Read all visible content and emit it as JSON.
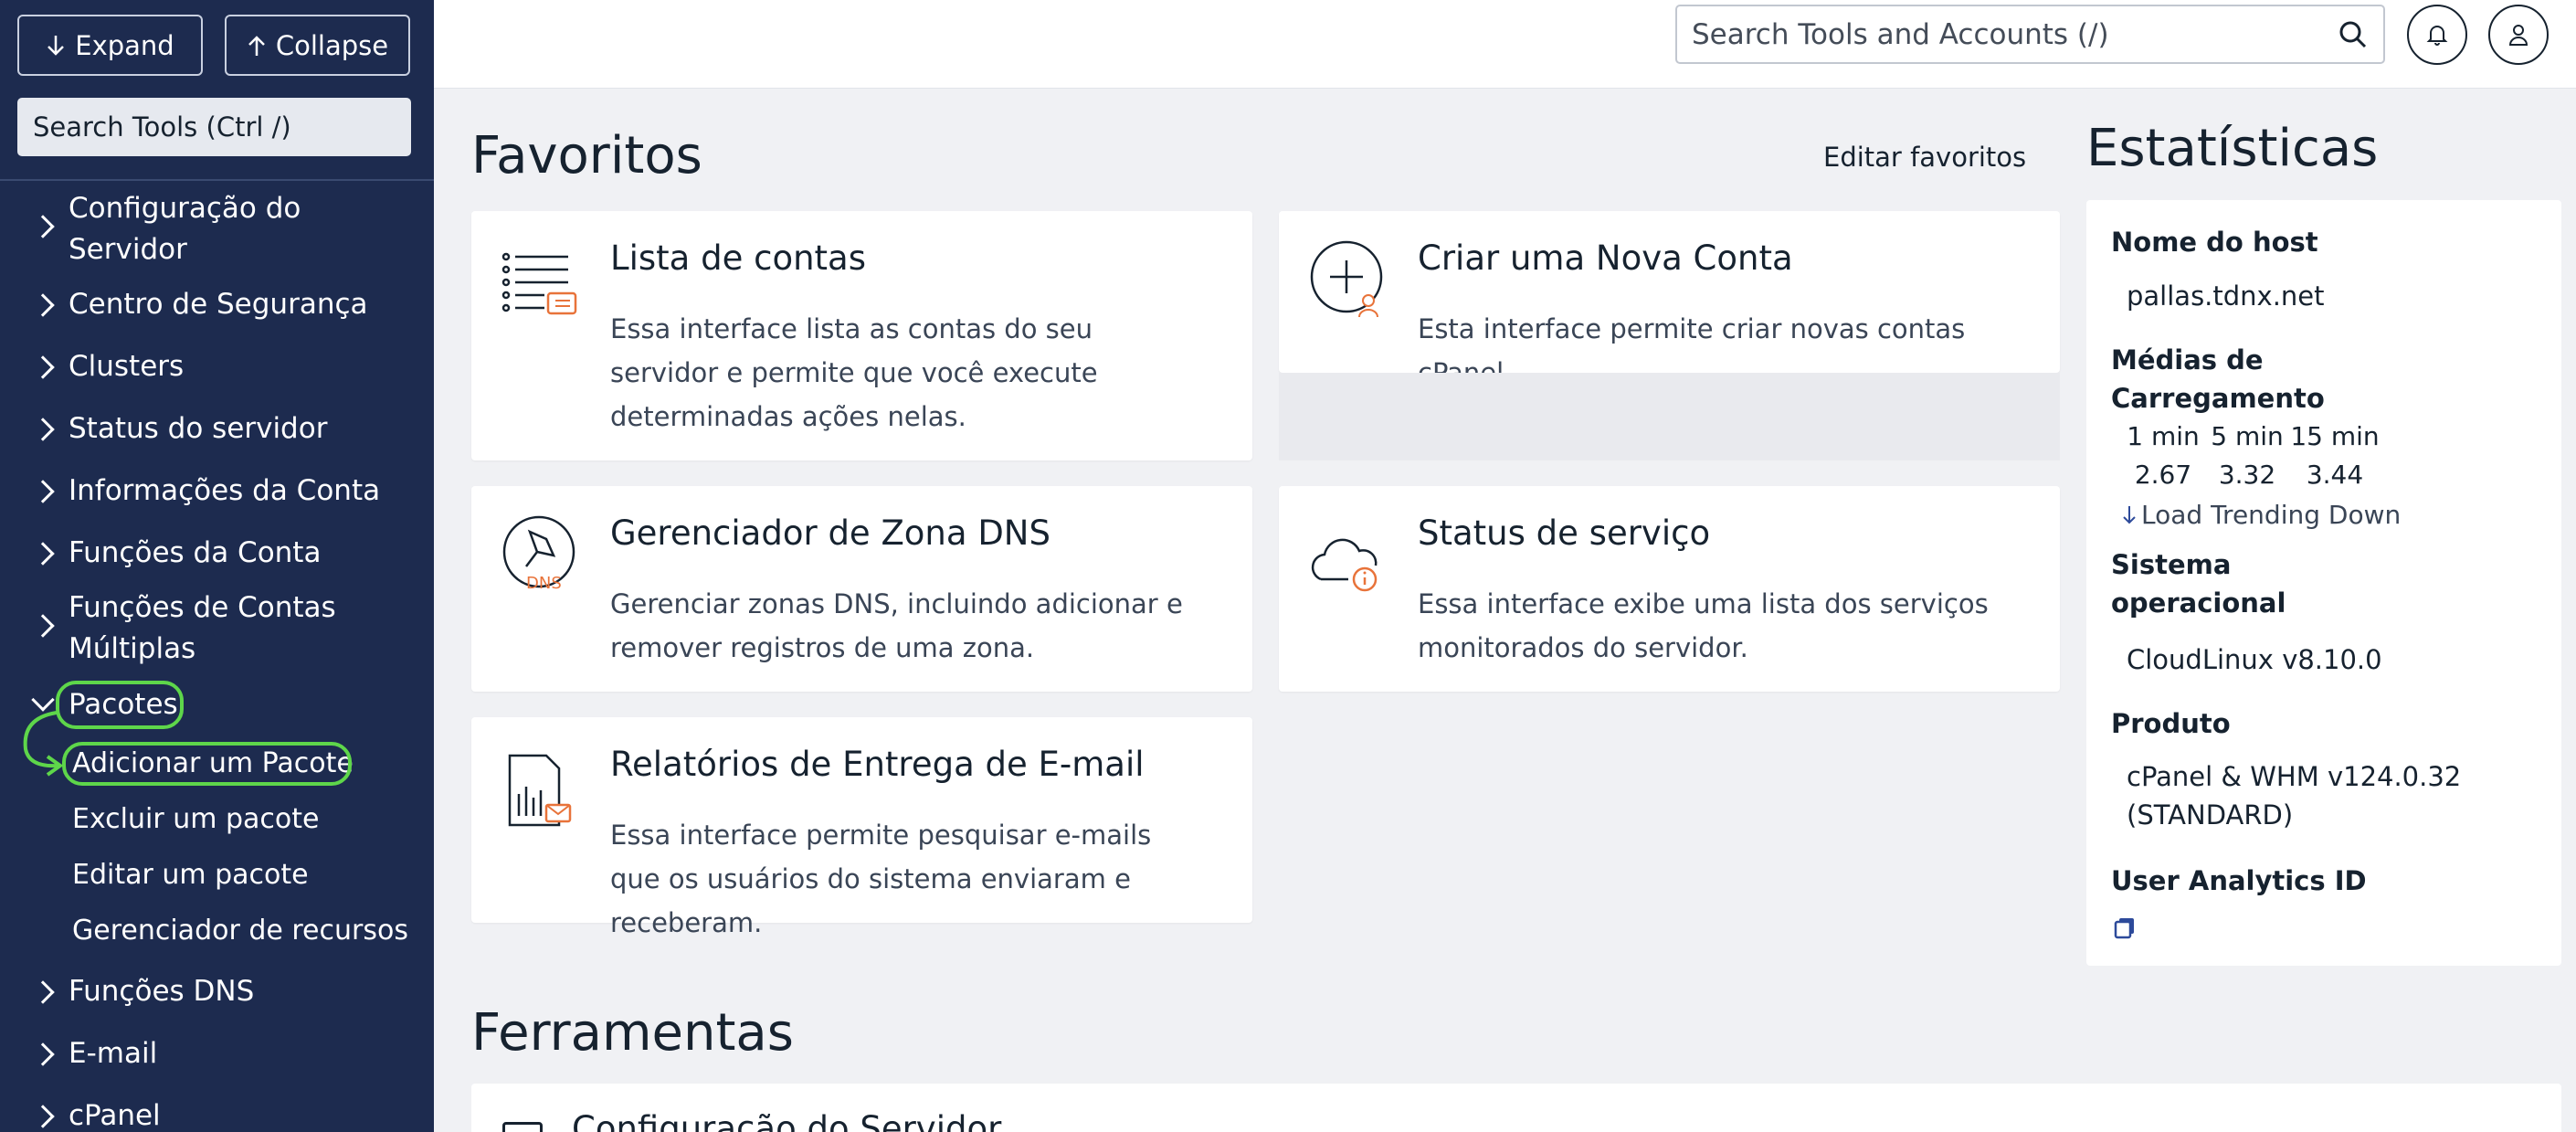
{
  "sidebar": {
    "expand_label": "Expand",
    "collapse_label": "Collapse",
    "search_placeholder": "Search Tools (Ctrl /)",
    "items": [
      {
        "label": "Configuração do Servidor"
      },
      {
        "label": "Centro de Segurança"
      },
      {
        "label": "Clusters"
      },
      {
        "label": "Status do servidor"
      },
      {
        "label": "Informações da Conta"
      },
      {
        "label": "Funções da Conta"
      },
      {
        "label": "Funções de Contas Múltiplas"
      },
      {
        "label": "Pacotes"
      },
      {
        "label": "Funções DNS"
      },
      {
        "label": "E-mail"
      },
      {
        "label": "cPanel"
      }
    ],
    "pacotes_sub": [
      {
        "label": "Adicionar um Pacote"
      },
      {
        "label": "Excluir um pacote"
      },
      {
        "label": "Editar um pacote"
      },
      {
        "label": "Gerenciador de recursos"
      }
    ]
  },
  "header": {
    "search_placeholder": "Search Tools and Accounts (/)"
  },
  "favorites": {
    "title": "Favoritos",
    "edit_label": "Editar favoritos",
    "cards": [
      {
        "title": "Lista de contas",
        "desc": "Essa interface lista as contas do seu servidor e permite que você execute determinadas ações nelas."
      },
      {
        "title": "Criar uma Nova Conta",
        "desc": "Esta interface permite criar novas contas cPanel."
      },
      {
        "title": "Gerenciador de Zona DNS",
        "desc": "Gerenciar zonas DNS, incluindo adicionar e remover registros de uma zona."
      },
      {
        "title": "Status de serviço",
        "desc": "Essa interface exibe uma lista dos serviços monitorados do servidor."
      },
      {
        "title": "Relatórios de Entrega de E-mail",
        "desc": "Essa interface permite pesquisar e-mails que os usuários do sistema enviaram e receberam."
      }
    ],
    "dns_icon_text": "DNS"
  },
  "stats": {
    "title": "Estatísticas",
    "hostname_label": "Nome do host",
    "hostname": "pallas.tdnx.net",
    "load_label": "Médias de Carregamento",
    "load_headers": [
      "1 min",
      "5 min",
      "15 min"
    ],
    "load_values": [
      "2.67",
      "3.32",
      "3.44"
    ],
    "load_trend": "Load Trending Down",
    "os_label": "Sistema operacional",
    "os": "CloudLinux v8.10.0",
    "product_label": "Produto",
    "product": "cPanel & WHM v124.0.32 (STANDARD)",
    "analytics_label": "User Analytics ID"
  },
  "tools": {
    "title": "Ferramentas",
    "first_item": "Configuração do Servidor"
  },
  "colors": {
    "sidebar_bg": "#1d2b4f",
    "highlight": "#5ed64a",
    "accent_orange": "#e8733a",
    "copy_icon": "#2d4a9a"
  }
}
